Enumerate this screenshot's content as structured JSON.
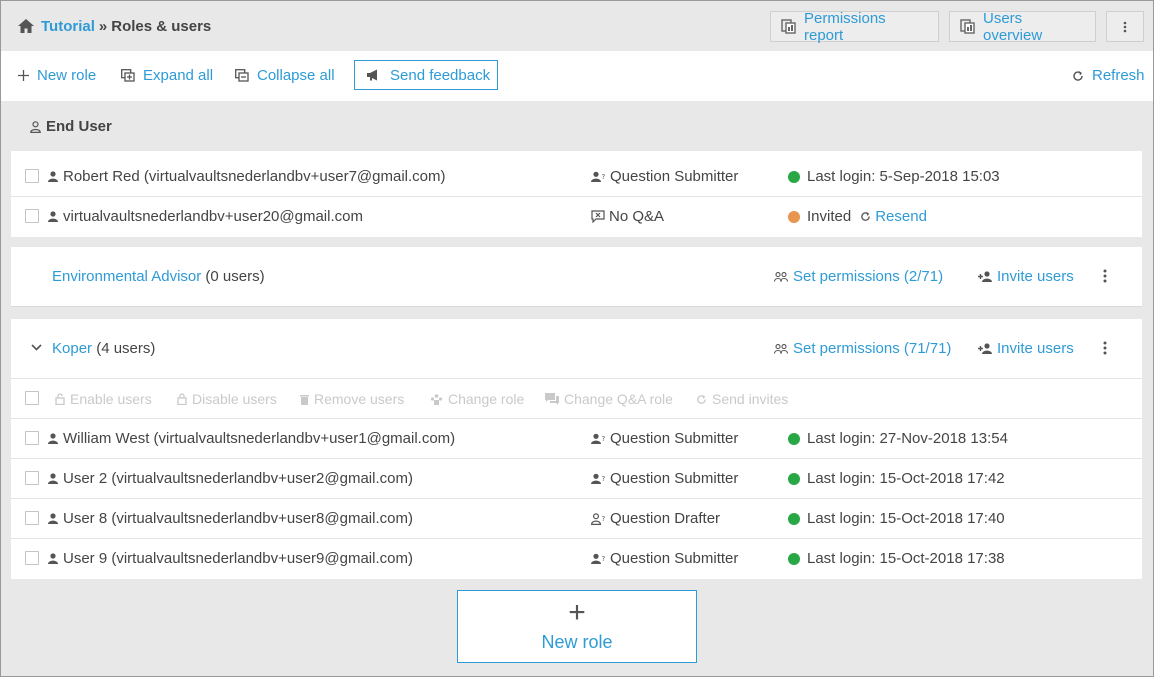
{
  "breadcrumb": {
    "root": "Tutorial",
    "separator": "»",
    "current": "Roles & users"
  },
  "header_buttons": {
    "permissions_report": "Permissions report",
    "users_overview": "Users overview"
  },
  "toolbar": {
    "new_role": "New role",
    "expand_all": "Expand all",
    "collapse_all": "Collapse all",
    "send_feedback": "Send feedback",
    "refresh": "Refresh"
  },
  "end_user": {
    "title": "End User",
    "users": [
      {
        "name": "Robert Red (virtualvaultsnederlandbv+user7@gmail.com)",
        "role": "Question Submitter",
        "status": "Last login: 5-Sep-2018 15:03",
        "status_color": "#27a844"
      },
      {
        "name": "virtualvaultsnederlandbv+user20@gmail.com",
        "role": "No Q&A",
        "status": "Invited",
        "status_color": "#e8954f",
        "resend": "Resend"
      }
    ]
  },
  "environmental_advisor": {
    "name": "Environmental Advisor",
    "count": "(0 users)",
    "set_permissions": "Set permissions (2/71)",
    "invite": "Invite users"
  },
  "koper": {
    "name": "Koper",
    "count": "(4 users)",
    "set_permissions": "Set permissions (71/71)",
    "invite": "Invite users",
    "bulk": {
      "enable": "Enable users",
      "disable": "Disable users",
      "remove": "Remove users",
      "change_role": "Change role",
      "change_qa": "Change Q&A role",
      "send_invites": "Send invites"
    },
    "users": [
      {
        "name": "William West (virtualvaultsnederlandbv+user1@gmail.com)",
        "role": "Question Submitter",
        "status": "Last login: 27-Nov-2018 13:54"
      },
      {
        "name": "User 2 (virtualvaultsnederlandbv+user2@gmail.com)",
        "role": "Question Submitter",
        "status": "Last login: 15-Oct-2018 17:42"
      },
      {
        "name": "User 8 (virtualvaultsnederlandbv+user8@gmail.com)",
        "role": "Question Drafter",
        "status": "Last login: 15-Oct-2018 17:40"
      },
      {
        "name": "User 9 (virtualvaultsnederlandbv+user9@gmail.com)",
        "role": "Question Submitter",
        "status": "Last login: 15-Oct-2018 17:38"
      }
    ]
  },
  "new_role_box": {
    "plus": "+",
    "label": "New role"
  },
  "colors": {
    "accent": "#2e9bd6",
    "active": "#27a844",
    "invited": "#e8954f"
  }
}
